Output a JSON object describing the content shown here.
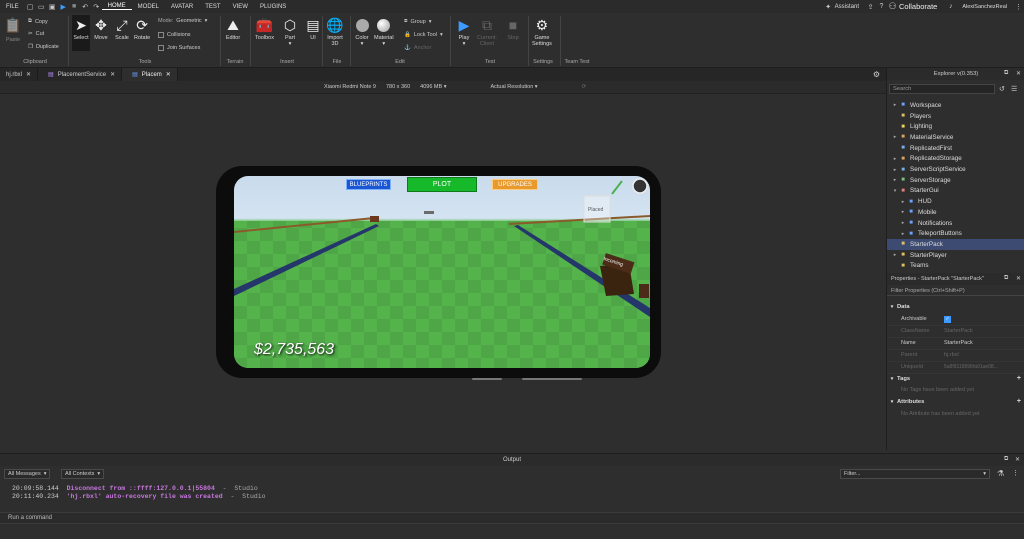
{
  "menubar": {
    "file": "FILE",
    "tabs": [
      "HOME",
      "MODEL",
      "AVATAR",
      "TEST",
      "VIEW",
      "PLUGINS"
    ],
    "assistant": "Assistant",
    "collaborate": "Collaborate",
    "username": "AlexiSanchezReal"
  },
  "ribbon": {
    "paste": "Paste",
    "copy": "Copy",
    "cut": "Cut",
    "duplicate": "Duplicate",
    "clipboard_group": "Clipboard",
    "select": "Select",
    "move": "Move",
    "scale": "Scale",
    "rotate": "Rotate",
    "mode_label": "Mode:",
    "mode_value": "Geometric",
    "collisions": "Collisions",
    "join_surfaces": "Join Surfaces",
    "tools_group": "Tools",
    "editor": "Editor",
    "terrain_group": "Terrain",
    "toolbox": "Toolbox",
    "part": "Part",
    "ui": "UI",
    "insert_group": "Insert",
    "import3d": "Import\n3D",
    "file_group": "File",
    "color": "Color",
    "material": "Material",
    "group": "Group",
    "lock_tool": "Lock Tool",
    "anchor": "Anchor",
    "edit_group": "Edit",
    "play": "Play",
    "current_client": "Current:\nClient",
    "stop": "Stop",
    "test_group": "Test",
    "game_settings": "Game\nSettings",
    "settings_group": "Settings",
    "team_test_group": "Team Test"
  },
  "doc_tabs": [
    {
      "label": "hj.rbxl"
    },
    {
      "label": "PlacementService"
    },
    {
      "label": "Placem"
    }
  ],
  "viewport_bar": {
    "device": "Xiaomi Redmi Note 9",
    "resolution": "780 x 360",
    "memory": "4096 MB",
    "actual_resolution": "Actual Resolution"
  },
  "game": {
    "blueprints": "BLUEPRINTS",
    "plot": "PLOT",
    "upgrades": "UPGRADES",
    "money": "$2,735,563",
    "sign_text": "Incoming",
    "tower_label": "Placed"
  },
  "explorer": {
    "title": "Explorer v(0.353)",
    "search_placeholder": "Search",
    "items": [
      {
        "label": "Workspace",
        "icon": "globe-icon",
        "color": "#6ca3ff"
      },
      {
        "label": "Players",
        "icon": "players-icon",
        "color": "#e0c060"
      },
      {
        "label": "Lighting",
        "icon": "bulb-icon",
        "color": "#f3d45c"
      },
      {
        "label": "MaterialService",
        "icon": "material-icon",
        "color": "#d9a560"
      },
      {
        "label": "ReplicatedFirst",
        "icon": "replicated-icon",
        "color": "#7aaee8"
      },
      {
        "label": "ReplicatedStorage",
        "icon": "storage-icon",
        "color": "#d9a560"
      },
      {
        "label": "ServerScriptService",
        "icon": "script-service-icon",
        "color": "#7aaee8"
      },
      {
        "label": "ServerStorage",
        "icon": "server-storage-icon",
        "color": "#7fbf7f"
      },
      {
        "label": "StarterGui",
        "icon": "gui-icon",
        "color": "#e08080"
      },
      {
        "label": "HUD",
        "icon": "screengui-icon",
        "color": "#6ca3ff"
      },
      {
        "label": "Mobile",
        "icon": "screengui-icon",
        "color": "#6ca3ff"
      },
      {
        "label": "Notifications",
        "icon": "screengui-icon",
        "color": "#6ca3ff"
      },
      {
        "label": "TeleportButtons",
        "icon": "screengui-icon",
        "color": "#6ca3ff"
      },
      {
        "label": "StarterPack",
        "icon": "pack-icon",
        "color": "#e0c060"
      },
      {
        "label": "StarterPlayer",
        "icon": "player-icon",
        "color": "#e0c060"
      },
      {
        "label": "Teams",
        "icon": "teams-icon",
        "color": "#e0c060"
      }
    ]
  },
  "properties": {
    "title": "Properties - StarterPack \"StarterPack\"",
    "filter_placeholder": "Filter Properties (Ctrl+Shift+P)",
    "data_section": "Data",
    "rows": [
      {
        "key": "Archivable",
        "value": ""
      },
      {
        "key": "ClassName",
        "value": "StarterPack"
      },
      {
        "key": "Name",
        "value": "StarterPack"
      },
      {
        "key": "Parent",
        "value": "hj.rbxl"
      },
      {
        "key": "UniqueId",
        "value": "5a8f9118996fa91ae08..."
      }
    ],
    "tags_section": "Tags",
    "tags_empty": "No Tags have been added yet",
    "attributes_section": "Attributes",
    "attributes_empty": "No Attribute has been added yet"
  },
  "output": {
    "title": "Output",
    "all_messages": "All Messages",
    "all_contexts": "All Contexts",
    "filter_placeholder": "Filter...",
    "logs": [
      {
        "time": "20:09:58.144",
        "message": "Disconnect from ::ffff:127.0.0.1|55804",
        "source": "-  Studio"
      },
      {
        "time": "20:11:40.234",
        "message": "'hj.rbxl' auto-recovery file was created",
        "source": "-  Studio"
      }
    ],
    "command_placeholder": "Run a command"
  },
  "colors": {
    "accent_blue": "#3d9bff",
    "log_purple": "#c678dd",
    "selection": "#3d4b72",
    "plot_green": "#1fbf2f",
    "upgrades_orange": "#e89a2c"
  }
}
